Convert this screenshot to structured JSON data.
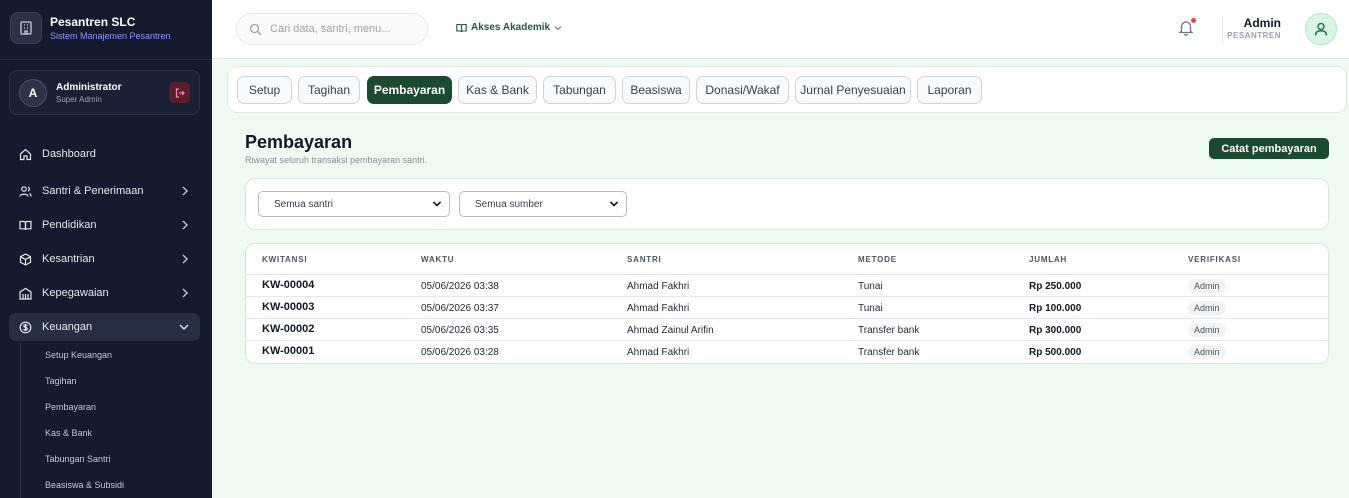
{
  "app": {
    "title": "Pesantren SLC",
    "subtitle": "Sistem Manajemen Pesantren"
  },
  "user": {
    "initial": "A",
    "name": "Administrator",
    "role": "Super Admin"
  },
  "sidebar": {
    "items": [
      {
        "label": "Dashboard",
        "icon": "home-icon"
      },
      {
        "label": "Santri & Penerimaan",
        "icon": "users-icon"
      },
      {
        "label": "Pendidikan",
        "icon": "book-icon"
      },
      {
        "label": "Kesantrian",
        "icon": "cube-icon"
      },
      {
        "label": "Kepegawaian",
        "icon": "building-icon"
      },
      {
        "label": "Keuangan",
        "icon": "dollar-icon"
      }
    ],
    "subitems": [
      "Setup Keuangan",
      "Tagihan",
      "Pembayaran",
      "Kas & Bank",
      "Tabungan Santri",
      "Beasiswa & Subsidi"
    ]
  },
  "header": {
    "search_placeholder": "Cari data, santri, menu...",
    "akses": "Akses Akademik",
    "admin_name": "Admin",
    "admin_role": "PESANTREN"
  },
  "tabs": [
    "Setup",
    "Tagihan",
    "Pembayaran",
    "Kas & Bank",
    "Tabungan",
    "Beasiswa",
    "Donasi/Wakaf",
    "Jurnal Penyesuaian",
    "Laporan"
  ],
  "active_tab": "Pembayaran",
  "page": {
    "title": "Pembayaran",
    "subtitle": "Riwayat seluruh transaksi pembayaran santri.",
    "primary_action": "Catat pembayaran"
  },
  "filters": {
    "santri": "Semua santri",
    "sumber": "Semua sumber"
  },
  "table": {
    "columns": [
      "KWITANSI",
      "WAKTU",
      "SANTRI",
      "METODE",
      "JUMLAH",
      "VERIFIKASI"
    ],
    "rows": [
      {
        "kwitansi": "KW-00004",
        "waktu": "05/06/2026 03:38",
        "santri": "Ahmad Fakhri",
        "metode": "Tunai",
        "jumlah": "Rp 250.000",
        "verifikasi": "Admin"
      },
      {
        "kwitansi": "KW-00003",
        "waktu": "05/06/2026 03:37",
        "santri": "Ahmad Fakhri",
        "metode": "Tunai",
        "jumlah": "Rp 100.000",
        "verifikasi": "Admin"
      },
      {
        "kwitansi": "KW-00002",
        "waktu": "05/06/2026 03:35",
        "santri": "Ahmad Zainul Arifin",
        "metode": "Transfer bank",
        "jumlah": "Rp 300.000",
        "verifikasi": "Admin"
      },
      {
        "kwitansi": "KW-00001",
        "waktu": "05/06/2026 03:28",
        "santri": "Ahmad Fakhri",
        "metode": "Transfer bank",
        "jumlah": "Rp 500.000",
        "verifikasi": "Admin"
      }
    ]
  },
  "colors": {
    "sidebar_bg": "#141b2e",
    "primary": "#1c4a2e",
    "page_bg": "#effaf1",
    "notification": "#ef4444"
  }
}
